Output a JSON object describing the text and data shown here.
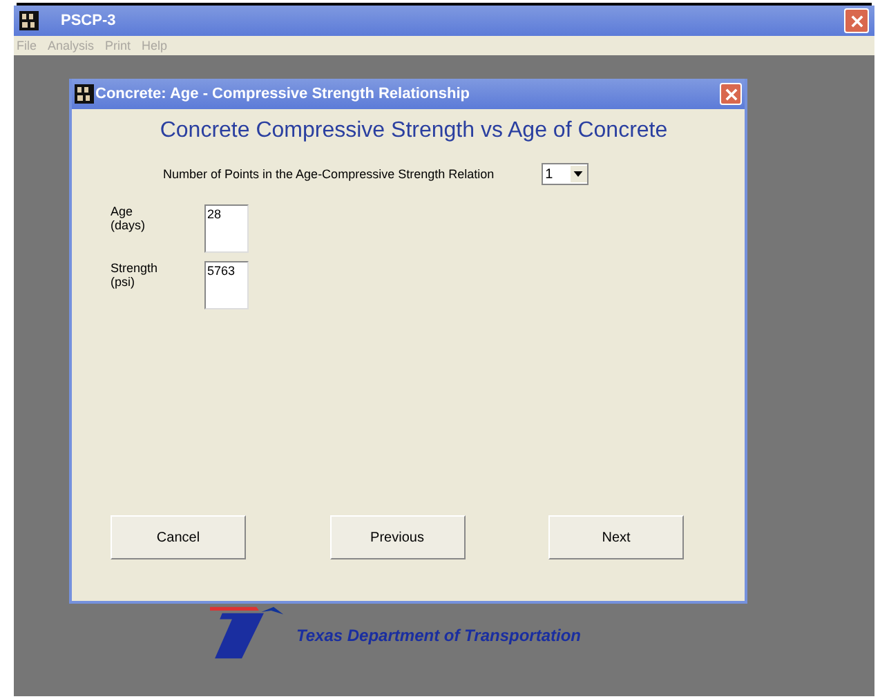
{
  "window": {
    "title": "PSCP-3"
  },
  "menu": [
    {
      "label": "File",
      "disabled": true
    },
    {
      "label": "Analysis",
      "disabled": true
    },
    {
      "label": "Print",
      "disabled": true
    },
    {
      "label": "Help",
      "disabled": true
    }
  ],
  "dialog": {
    "title": "Concrete: Age - Compressive Strength Relationship",
    "heading": "Concrete Compressive Strength  vs Age of Concrete",
    "points": {
      "label": "Number of Points in the Age-Compressive Strength Relation",
      "value": "1"
    },
    "fields": [
      {
        "label": "Age\n(days)",
        "value": "28"
      },
      {
        "label": "Strength\n(psi)",
        "value": "5763"
      }
    ],
    "buttons": [
      "Cancel",
      "Previous",
      "Next"
    ]
  },
  "footer": {
    "text": "Texas Department of Transportation"
  }
}
